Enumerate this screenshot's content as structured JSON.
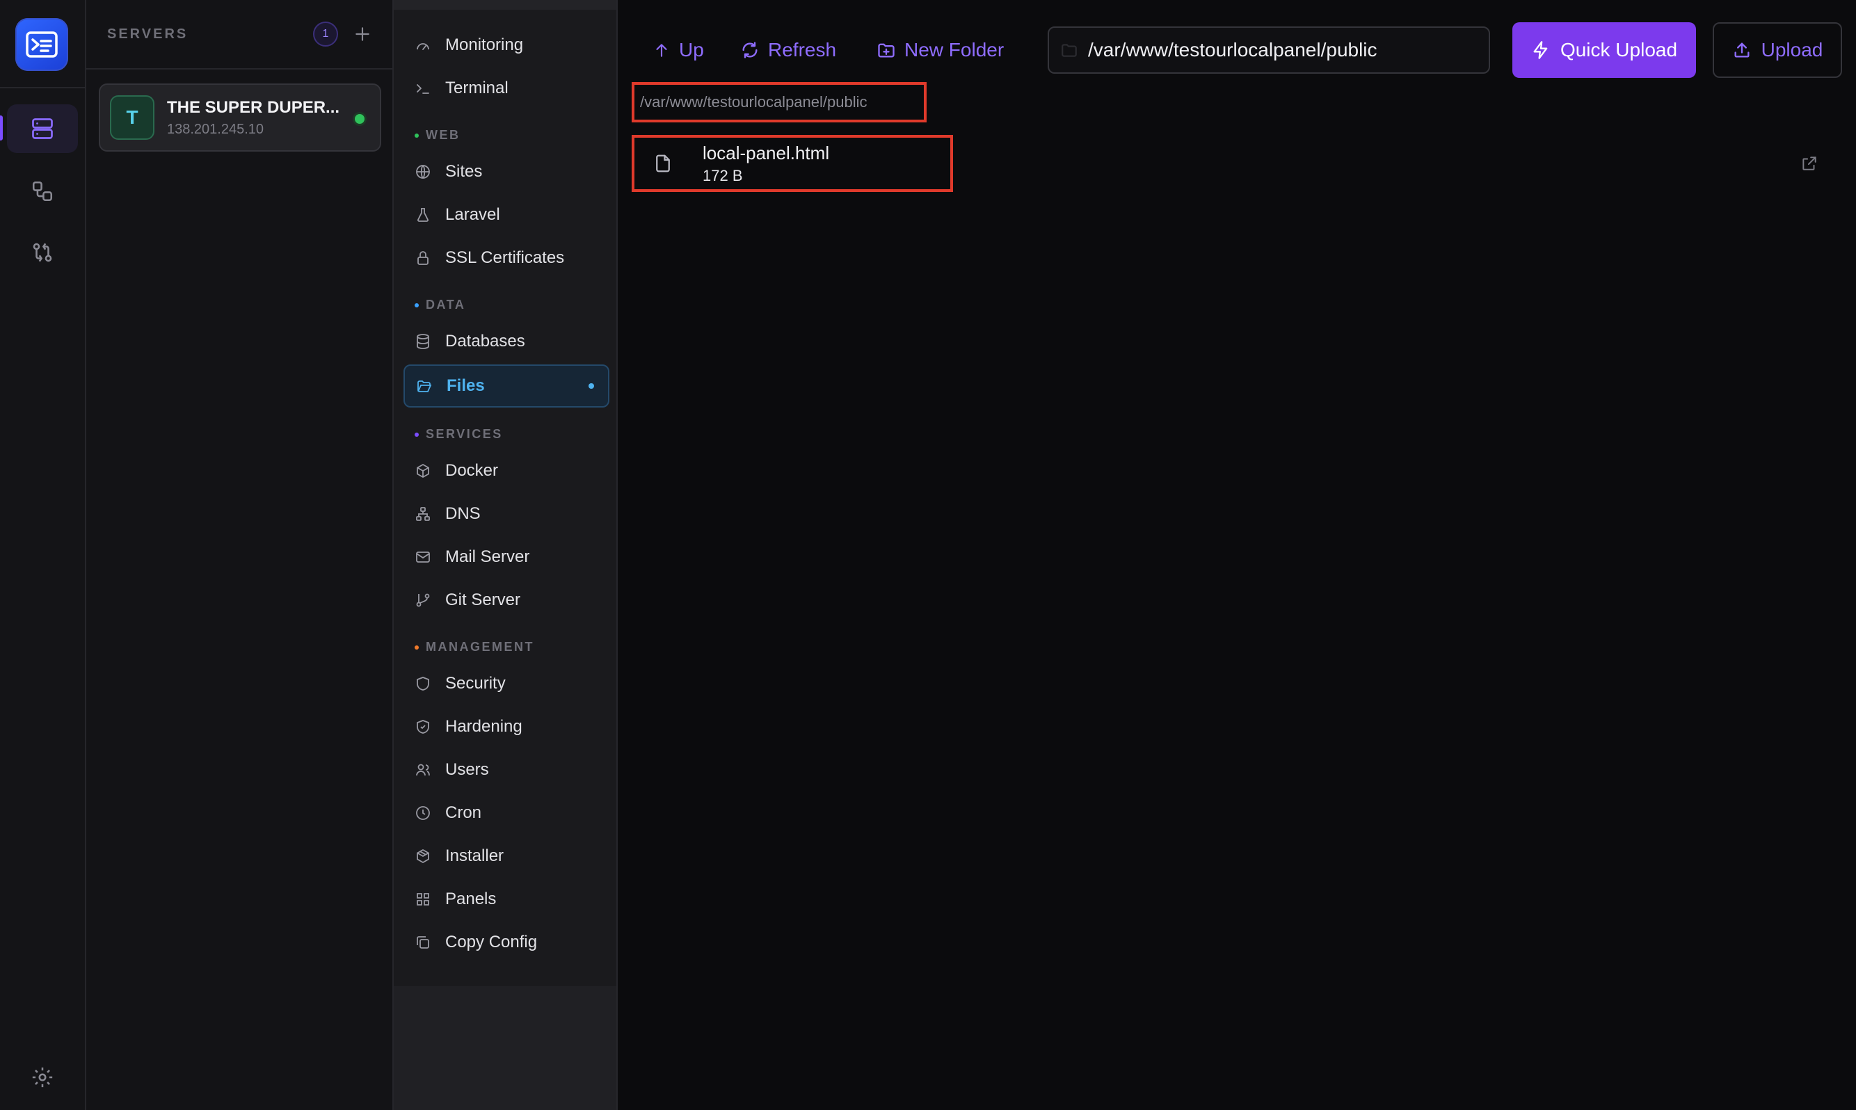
{
  "servers": {
    "title": "SERVERS",
    "count": "1",
    "items": [
      {
        "avatar": "T",
        "name": "THE SUPER DUPER...",
        "ip": "138.201.245.10",
        "status_color": "#2fc25b"
      }
    ]
  },
  "nav": {
    "top_items": [
      {
        "label": "Monitoring",
        "icon": "gauge-icon"
      },
      {
        "label": "Terminal",
        "icon": "terminal-icon"
      }
    ],
    "sections": [
      {
        "title": "WEB",
        "dot_color": "#2fc25b",
        "items": [
          {
            "label": "Sites",
            "icon": "globe-icon"
          },
          {
            "label": "Laravel",
            "icon": "flask-icon"
          },
          {
            "label": "SSL Certificates",
            "icon": "lock-icon"
          }
        ]
      },
      {
        "title": "DATA",
        "dot_color": "#3aa0ff",
        "items": [
          {
            "label": "Databases",
            "icon": "database-icon"
          },
          {
            "label": "Files",
            "icon": "folder-open-icon",
            "active": true
          }
        ]
      },
      {
        "title": "SERVICES",
        "dot_color": "#7c4dff",
        "items": [
          {
            "label": "Docker",
            "icon": "box-icon"
          },
          {
            "label": "DNS",
            "icon": "network-icon"
          },
          {
            "label": "Mail Server",
            "icon": "mail-icon"
          },
          {
            "label": "Git Server",
            "icon": "git-branch-icon"
          }
        ]
      },
      {
        "title": "MANAGEMENT",
        "dot_color": "#f07a2b",
        "items": [
          {
            "label": "Security",
            "icon": "shield-icon"
          },
          {
            "label": "Hardening",
            "icon": "shield-check-icon"
          },
          {
            "label": "Users",
            "icon": "users-icon"
          },
          {
            "label": "Cron",
            "icon": "clock-icon"
          },
          {
            "label": "Installer",
            "icon": "package-icon"
          },
          {
            "label": "Panels",
            "icon": "grid-icon"
          },
          {
            "label": "Copy Config",
            "icon": "copy-icon"
          }
        ]
      }
    ]
  },
  "toolbar": {
    "up_label": "Up",
    "refresh_label": "Refresh",
    "new_folder_label": "New Folder",
    "path_value": "/var/www/testourlocalpanel/public",
    "quick_upload_label": "Quick Upload",
    "upload_label": "Upload"
  },
  "breadcrumb": "/var/www/testourlocalpanel/public",
  "files": [
    {
      "name": "local-panel.html",
      "size": "172 B"
    }
  ],
  "colors": {
    "accent": "#7c3aed",
    "accent_text": "#8f6dff",
    "active_nav": "#4fb3f0",
    "highlight_border": "#e03a2b"
  }
}
